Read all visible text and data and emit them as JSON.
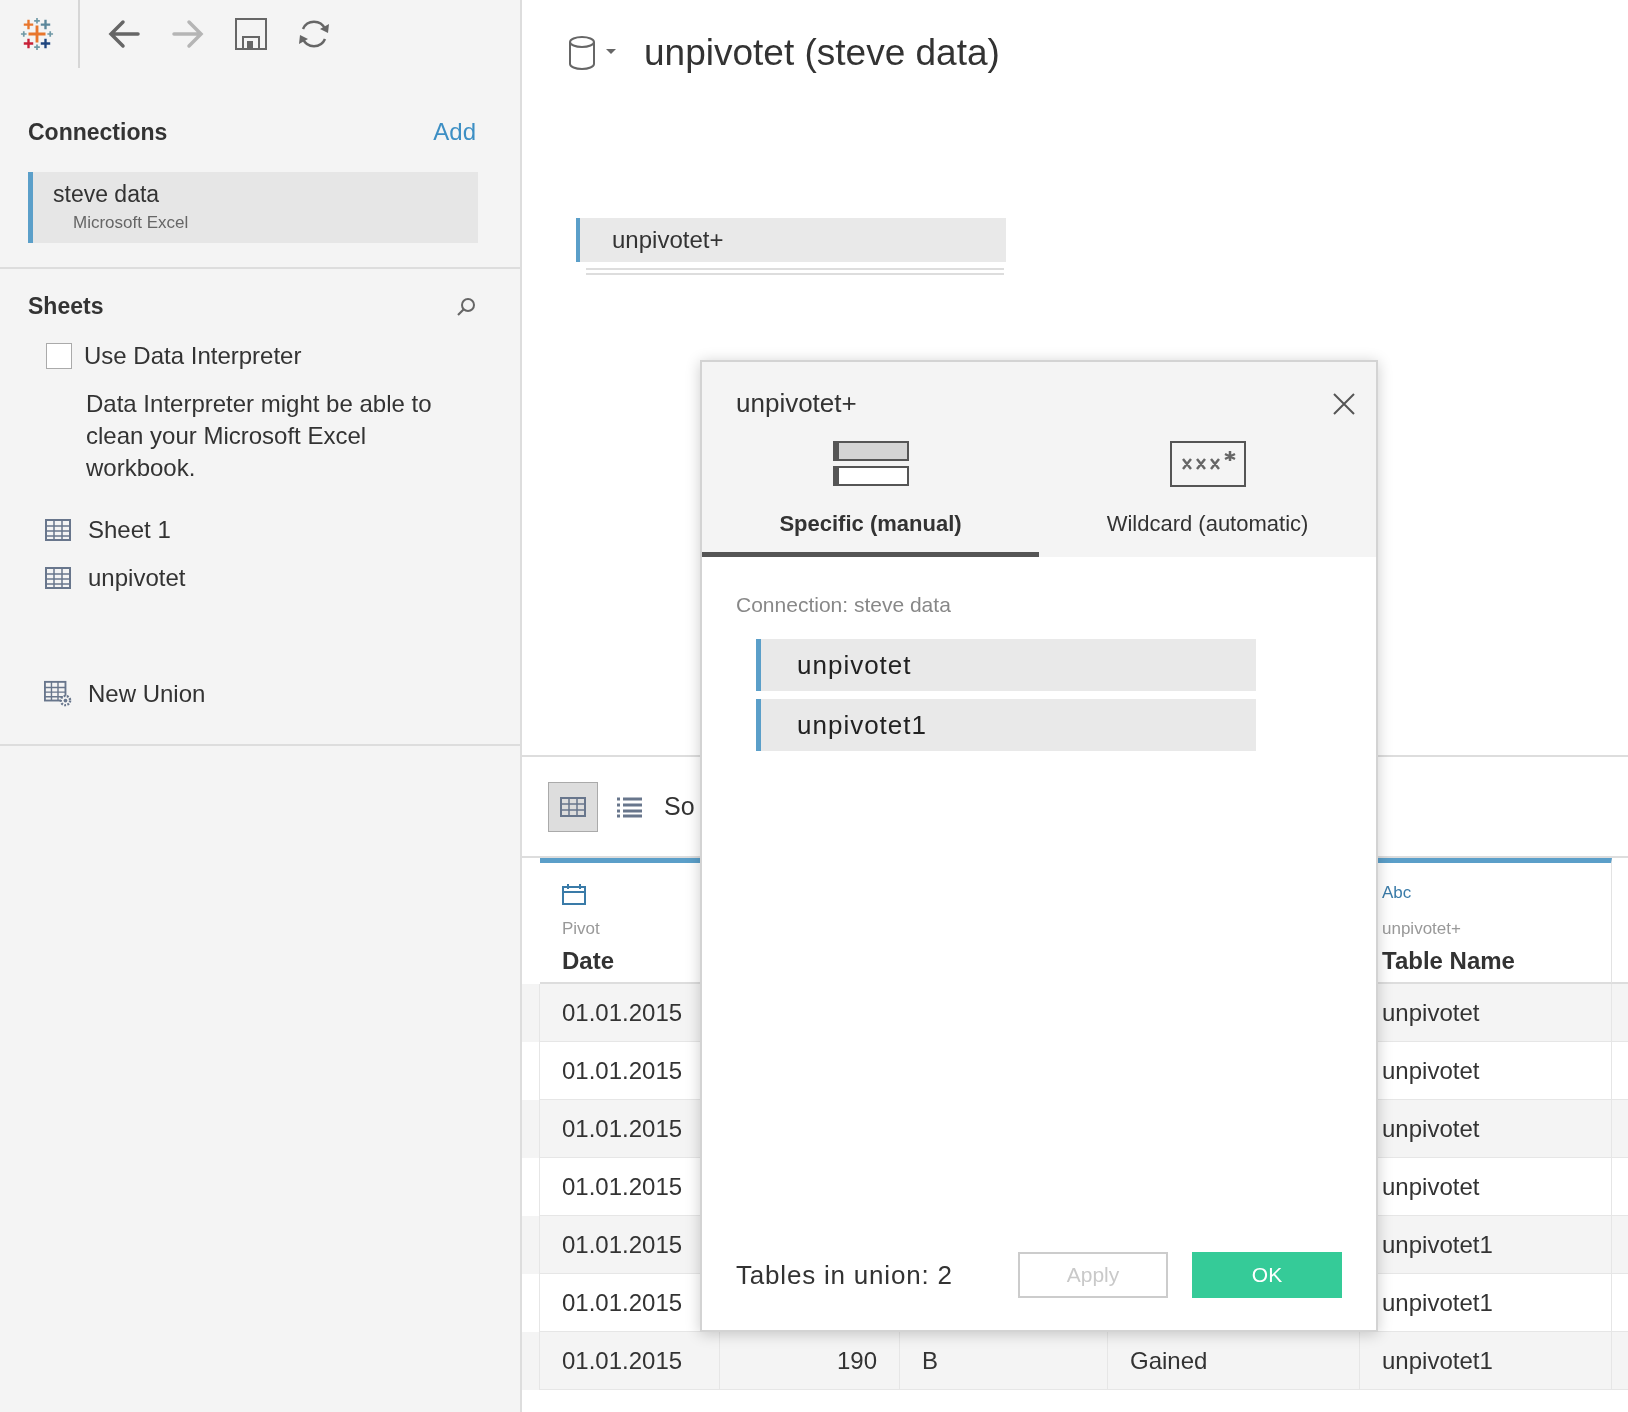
{
  "toolbar": {
    "buttons": [
      {
        "kind": "back",
        "disabled": false
      },
      {
        "kind": "forward",
        "disabled": true
      },
      {
        "kind": "save",
        "disabled": false
      },
      {
        "kind": "refresh",
        "disabled": false
      }
    ]
  },
  "connections": {
    "title": "Connections",
    "add_label": "Add",
    "items": [
      {
        "name": "steve data",
        "type": "Microsoft Excel"
      }
    ]
  },
  "sheets": {
    "title": "Sheets",
    "interpreter": {
      "label": "Use Data Interpreter",
      "checked": false,
      "description": "Data Interpreter might be able to clean your Microsoft Excel workbook."
    },
    "items": [
      {
        "kind": "sheet",
        "label": "Sheet 1"
      },
      {
        "kind": "sheet",
        "label": "unpivotet"
      },
      {
        "kind": "union",
        "label": "New Union"
      }
    ]
  },
  "datasource": {
    "title": "unpivotet (steve data)"
  },
  "canvas": {
    "table": "unpivotet+"
  },
  "data_view": {
    "modes": [
      {
        "kind": "grid",
        "selected": true
      },
      {
        "kind": "list",
        "selected": false
      }
    ],
    "label": "So"
  },
  "table": {
    "columns": [
      {
        "kind": "date",
        "source": "Pivot",
        "name": "Date"
      },
      {
        "kind": "covered"
      },
      {
        "kind": "covered"
      },
      {
        "kind": "covered"
      },
      {
        "kind": "string",
        "type_label": "Abc",
        "source": "unpivotet+",
        "name": "Table Name"
      }
    ],
    "rows": [
      [
        "01.01.2015",
        null,
        null,
        null,
        "unpivotet"
      ],
      [
        "01.01.2015",
        null,
        null,
        null,
        "unpivotet"
      ],
      [
        "01.01.2015",
        null,
        null,
        null,
        "unpivotet"
      ],
      [
        "01.01.2015",
        null,
        null,
        null,
        "unpivotet"
      ],
      [
        "01.01.2015",
        null,
        null,
        null,
        "unpivotet1"
      ],
      [
        "01.01.2015",
        null,
        null,
        null,
        "unpivotet1"
      ],
      [
        "01.01.2015",
        "190",
        "B",
        "Gained",
        "unpivotet1"
      ]
    ]
  },
  "dialog": {
    "title": "unpivotet+",
    "tabs": [
      {
        "kind": "specific",
        "label": "Specific (manual)",
        "selected": true
      },
      {
        "kind": "wildcard",
        "label": "Wildcard (automatic)",
        "selected": false
      }
    ],
    "connection_label": "Connection: steve data",
    "tables": [
      "unpivotet",
      "unpivotet1"
    ],
    "count_label": "Tables in union: 2",
    "buttons": [
      {
        "kind": "apply",
        "label": "Apply",
        "disabled": true
      },
      {
        "kind": "ok",
        "label": "OK",
        "disabled": false
      }
    ]
  }
}
